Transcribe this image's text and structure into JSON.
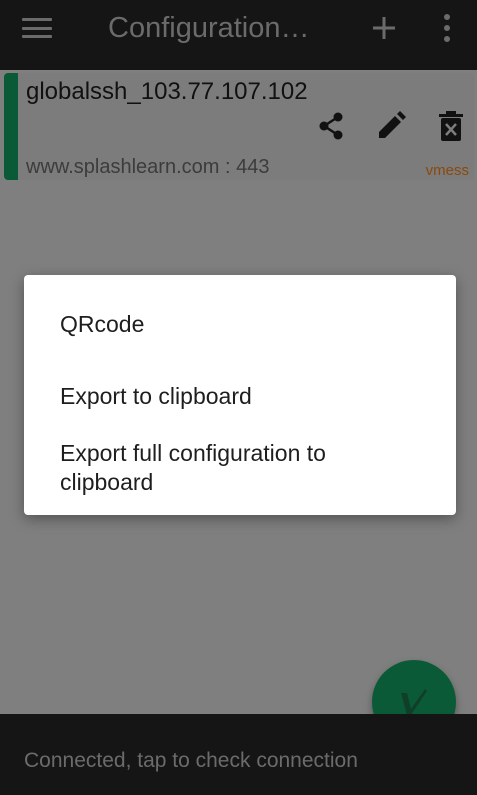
{
  "toolbar": {
    "title": "Configuration…",
    "menu_icon": "hamburger-menu-icon",
    "add_icon": "plus-icon",
    "more_icon": "vertical-dots-icon",
    "background": "#151515",
    "icon_color": "#6b6b6b"
  },
  "server_card": {
    "name": "globalssh_103.77.107.102",
    "address": "www.splashlearn.com : 443",
    "type": "vmess",
    "indicator_color": "#0b5a37",
    "type_color": "#8a4a0c",
    "actions": [
      "share-icon",
      "edit-icon",
      "delete-icon"
    ]
  },
  "dialog": {
    "items": [
      "QRcode",
      "Export to clipboard",
      "Export full configuration to clipboard"
    ]
  },
  "fab": {
    "icon": "connected-check-icon",
    "color": "#0b5a37"
  },
  "status": {
    "text": "Connected, tap to check connection"
  }
}
